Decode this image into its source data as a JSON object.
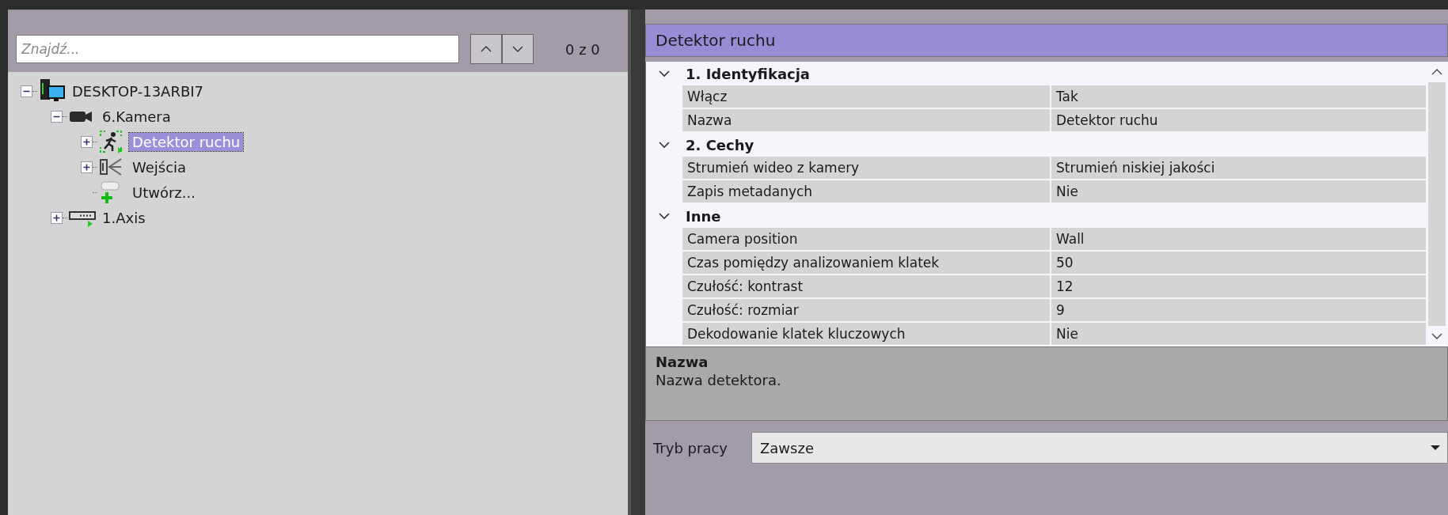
{
  "search": {
    "placeholder": "Znajdź...",
    "counter": "0 z 0"
  },
  "tree": [
    {
      "label": "DESKTOP-13ARBI7",
      "kind": "computer",
      "expandable": true,
      "expanded": true,
      "selected": false,
      "children": [
        {
          "label": "6.Kamera",
          "kind": "camera",
          "expandable": true,
          "expanded": true,
          "selected": false,
          "children": [
            {
              "label": "Detektor ruchu",
              "kind": "detector",
              "expandable": true,
              "selected": true
            },
            {
              "label": "Wejścia",
              "kind": "inputs",
              "expandable": true,
              "selected": false
            },
            {
              "label": "Utwórz...",
              "kind": "create",
              "selected": false
            }
          ]
        },
        {
          "label": "1.Axis",
          "kind": "device",
          "expandable": true,
          "selected": false
        }
      ]
    }
  ],
  "panel": {
    "title": "Detektor ruchu"
  },
  "sections": [
    {
      "title": "1. Identyfikacja",
      "expanded": true,
      "rows": [
        {
          "name": "Włącz",
          "value": "Tak"
        },
        {
          "name": "Nazwa",
          "value": "Detektor ruchu"
        }
      ]
    },
    {
      "title": "2. Cechy",
      "expanded": true,
      "rows": [
        {
          "name": "Strumień wideo z kamery",
          "value": "Strumień niskiej jakości"
        },
        {
          "name": "Zapis metadanych",
          "value": "Nie"
        }
      ]
    },
    {
      "title": "Inne",
      "expanded": true,
      "rows": [
        {
          "name": "Camera position",
          "value": "Wall"
        },
        {
          "name": "Czas pomiędzy analizowaniem klatek",
          "value": "50"
        },
        {
          "name": "Czułość: kontrast",
          "value": "12"
        },
        {
          "name": "Czułość: rozmiar",
          "value": "9"
        },
        {
          "name": "Dekodowanie klatek kluczowych",
          "value": "Nie"
        }
      ]
    }
  ],
  "description": {
    "title": "Nazwa",
    "text": "Nazwa detektora."
  },
  "mode": {
    "label": "Tryb pracy",
    "value": "Zawsze"
  }
}
